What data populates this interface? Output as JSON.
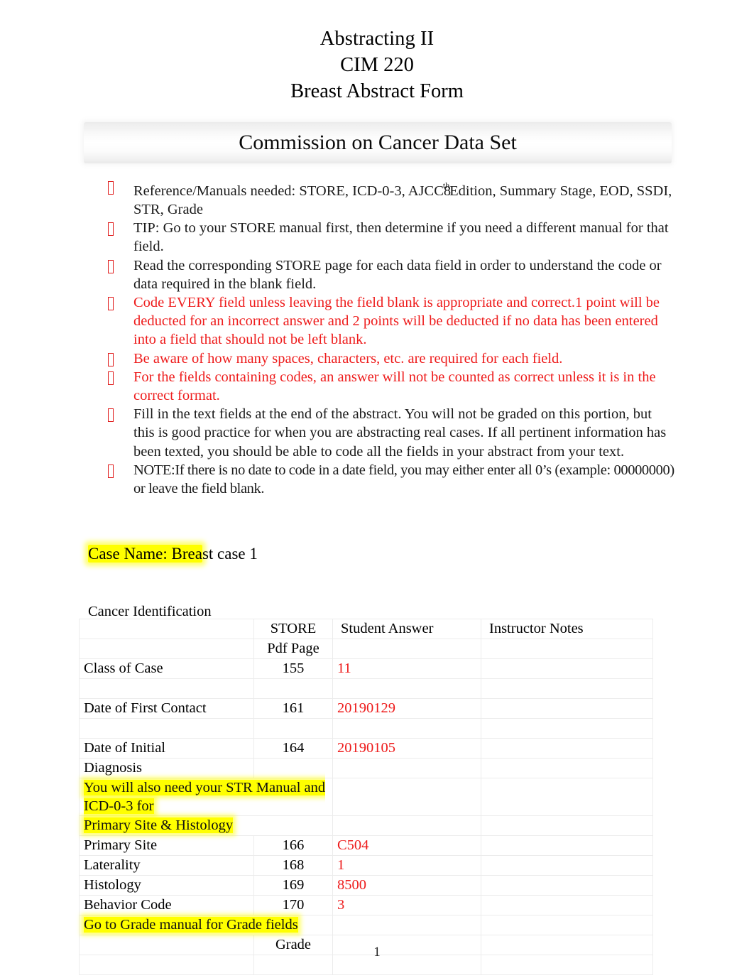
{
  "header": {
    "line1": "Abstracting II",
    "line2": "CIM 220",
    "line3": "Breast Abstract Form"
  },
  "banner": {
    "title": "Commission on Cancer Data Set"
  },
  "instructions": [
    {
      "id": "references",
      "color": "#1a1a1a",
      "segments": [
        {
          "text": "Reference/Manuals needed: STORE, ICD-0-3, AJCC"
        },
        {
          "text": "th",
          "style": "superscript"
        },
        {
          "text": "8"
        },
        {
          "text": "Edition, Summary Stage, EOD, SSDI, STR, Grade"
        }
      ],
      "plain": "Reference/Manuals needed: STORE, ICD-0-3, AJCC 8th Edition, Summary Stage, EOD, SSDI, STR, Grade"
    },
    {
      "id": "tip-store-manual",
      "color": "#1a1a1a",
      "plain": "TIP: Go to your STORE manual first, then determine if you need a different manual for that field."
    },
    {
      "id": "read-store-page",
      "color": "#1a1a1a",
      "plain": "Read the corresponding STORE page for each data field in order to understand the code or data required in the blank field."
    },
    {
      "id": "code-every-field",
      "color": "#ee1c1c",
      "plain": "Code EVERY field unless leaving the field blank is appropriate and correct.1 point will be deducted for an incorrect answer and 2 points will be deducted if no data has been entered into a field that should not be left blank."
    },
    {
      "id": "spaces-characters",
      "color": "#ee1c1c",
      "plain": "Be aware of how many spaces, characters, etc. are required for each field."
    },
    {
      "id": "correct-format",
      "color": "#ee1c1c",
      "plain": "For the fields containing codes, an answer will not be counted as correct unless it is in the correct format."
    },
    {
      "id": "fill-text-fields",
      "color": "#1a1a1a",
      "plain": "Fill in the text fields at the end of the abstract.    You will not be graded on this portion, but this is good practice for when you are abstracting real cases.    If all pertinent information has been texted, you should be able to code all the fields in your abstract from your text."
    },
    {
      "id": "note-date-fields",
      "color": "#1a1a1a",
      "plain": "NOTE:If there is no date to code in a date field, you may either enter all 0’s (example: 00000000) or leave the field blank."
    }
  ],
  "bullet_glyph": "missing-glyph-box",
  "case": {
    "label_highlighted": "Case Name: Brea",
    "label_rest": "st case 1",
    "full": "Case Name: Breast case 1"
  },
  "section": {
    "label": "Cancer Identification"
  },
  "table": {
    "columns": [
      "",
      "STORE Pdf Page",
      "Student Answer",
      "Instructor Notes"
    ],
    "header": {
      "col1": "",
      "col2_line1": "STORE",
      "col2_line2": "Pdf Page",
      "col3": "Student Answer",
      "col4": "Instructor Notes"
    },
    "rows": [
      {
        "type": "data",
        "label": "Class of Case",
        "page": "155",
        "answer": "11",
        "notes": ""
      },
      {
        "type": "spacer"
      },
      {
        "type": "data",
        "label": "Date of First Contact",
        "page": "161",
        "answer": "20190129",
        "notes": ""
      },
      {
        "type": "spacer"
      },
      {
        "type": "data",
        "label": "Date of Initial",
        "page": "164",
        "answer": "20190105",
        "notes": ""
      },
      {
        "type": "data",
        "label": "Diagnosis",
        "page": "",
        "answer": "",
        "notes": ""
      },
      {
        "type": "note",
        "text_line1": "You will also need your STR Manual and ICD-0-3 for",
        "text_line2": "Primary Site & Histology"
      },
      {
        "type": "data",
        "label": "Primary Site",
        "page": "166",
        "answer": "C504",
        "notes": ""
      },
      {
        "type": "data",
        "label": "Laterality",
        "page": "168",
        "answer": "1",
        "notes": ""
      },
      {
        "type": "data",
        "label": "Histology",
        "page": "169",
        "answer": "8500",
        "notes": ""
      },
      {
        "type": "data",
        "label": "Behavior Code",
        "page": "170",
        "answer": "3",
        "notes": ""
      },
      {
        "type": "note",
        "text_line1": "Go to Grade manual for Grade fields",
        "text_line2": ""
      },
      {
        "type": "data",
        "label": "",
        "page": "Grade",
        "answer": "",
        "notes": ""
      },
      {
        "type": "spacer"
      }
    ]
  },
  "footer": {
    "page_number": "1"
  },
  "colors": {
    "red_text": "#ee1c1c",
    "highlight": "#ffff00",
    "body_text": "#1a1a1a",
    "table_border": "#ececec",
    "banner_bg": "#f2f2f2"
  }
}
